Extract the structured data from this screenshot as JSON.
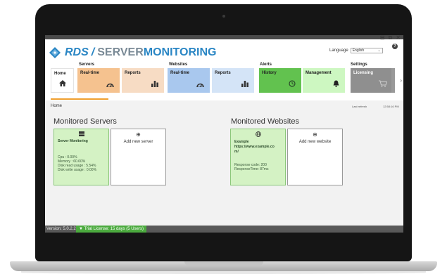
{
  "app": {
    "logo_text_1": "RDS",
    "logo_sep": "/",
    "logo_text_2": "SERVER",
    "logo_text_3": "MONITORING",
    "language_label": "Language",
    "language_value": "English",
    "help": "?"
  },
  "window_controls": [
    "⊟",
    "⧉",
    "✕"
  ],
  "nav": {
    "groups": {
      "servers": "Servers",
      "websites": "Websites",
      "alerts": "Alerts",
      "settings": "Settings"
    },
    "tiles": [
      {
        "label": "Home",
        "icon": "home-icon",
        "color": "#ffffff"
      },
      {
        "label": "Real-time",
        "icon": "gauge-icon",
        "color": "#f5c28f"
      },
      {
        "label": "Reports",
        "icon": "bar-chart-icon",
        "color": "#f7dcc4"
      },
      {
        "label": "Real-time",
        "icon": "gauge-icon",
        "color": "#a9c8ee"
      },
      {
        "label": "Reports",
        "icon": "bar-chart-icon",
        "color": "#d4e4f7"
      },
      {
        "label": "History",
        "icon": "history-icon",
        "color": "#62c24f"
      },
      {
        "label": "Management",
        "icon": "bell-icon",
        "color": "#cdf7c1"
      },
      {
        "label": "Licensing",
        "icon": "cart-icon",
        "color": "#8f8f8f"
      }
    ],
    "more_arrow": "›"
  },
  "breadcrumb": "Home",
  "last_refresh_label": "Last refresh",
  "last_refresh_time": "12:58:16 PM",
  "servers": {
    "title": "Monitored Servers",
    "card": {
      "name": "Server Monitoring",
      "lines": [
        "Cpu : 0.00%",
        "Memory : 60.60%",
        "Disk read usage : 5.54%",
        "Disk write usage : 0.00%"
      ]
    },
    "add_label": "Add new server"
  },
  "websites": {
    "title": "Monitored Websites",
    "card": {
      "name_line1": "Example",
      "name_line2": "https://www.example.co",
      "name_line3": "m/",
      "lines": [
        "Response code: 200",
        "ResponseTime: 87ms"
      ]
    },
    "add_label": "Add new website"
  },
  "footer": {
    "version": "Version: 5.0.2.2",
    "trial": "Trial License: 15 days (5 Users)"
  },
  "colors": {
    "brand_blue": "#2a86c4",
    "accent_orange": "#f0a030",
    "monitored_green": "#d4f2c4",
    "trial_green": "#4cab3f"
  }
}
